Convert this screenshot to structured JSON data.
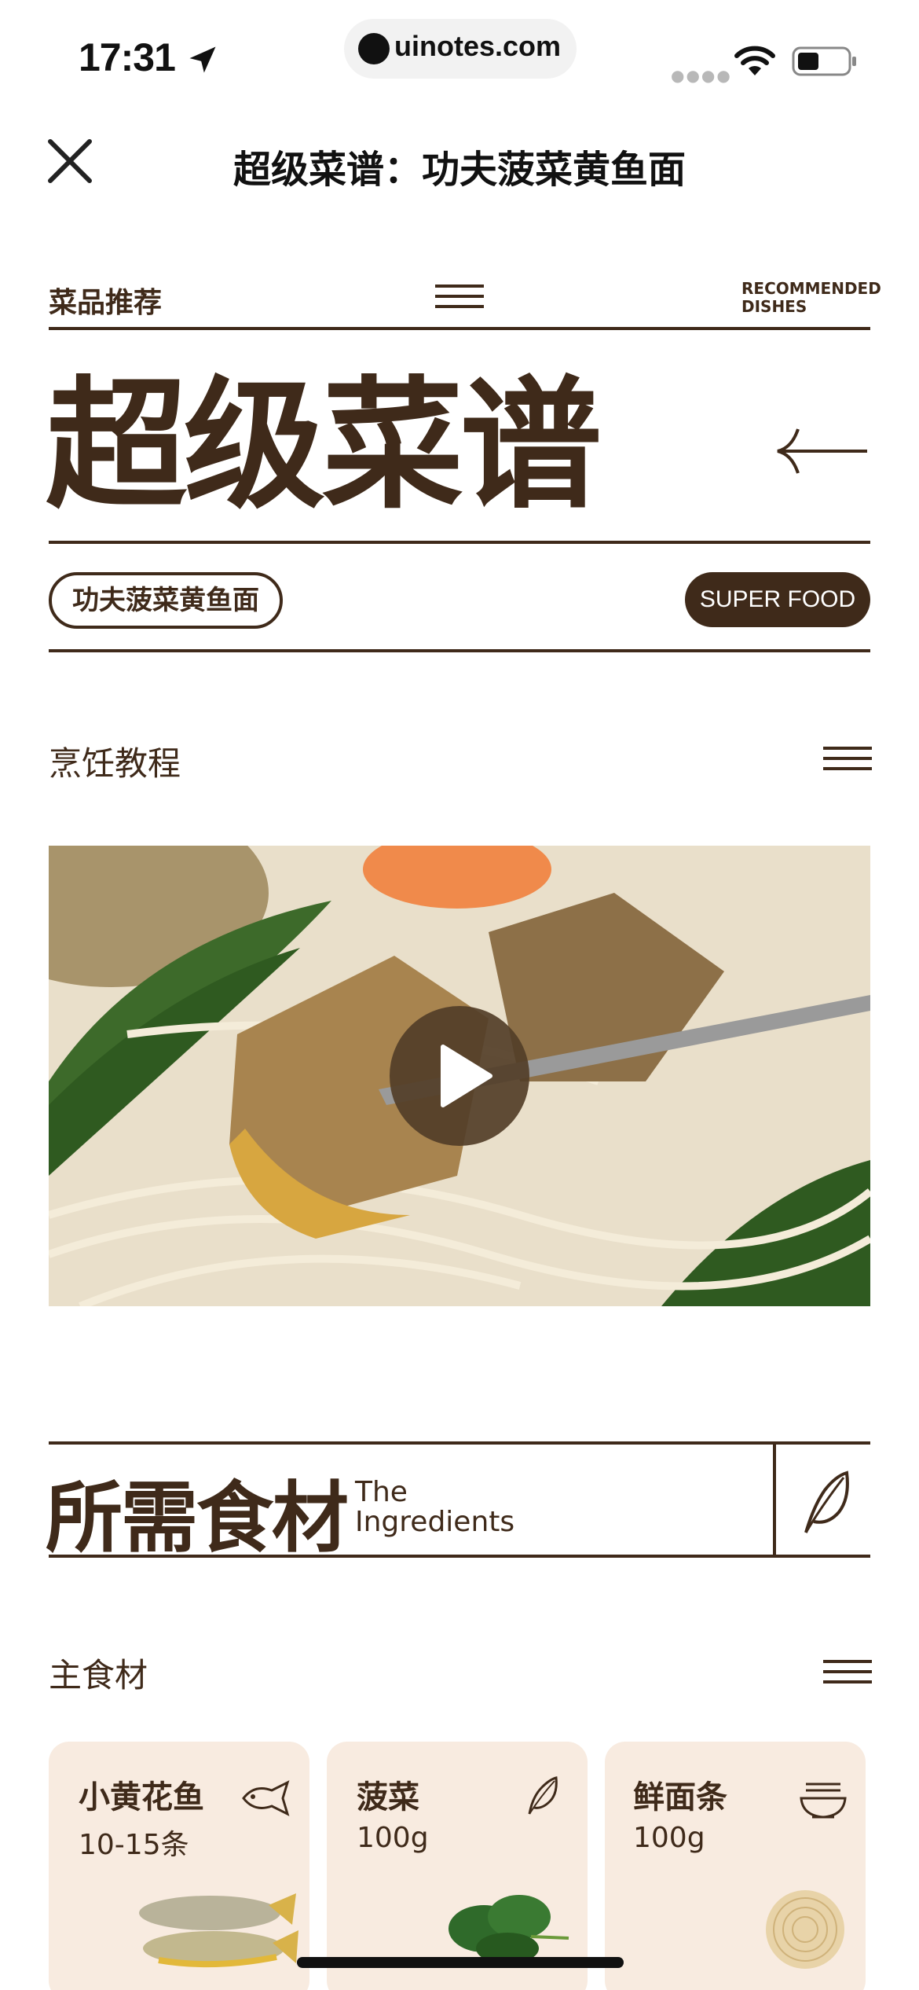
{
  "status_bar": {
    "time": "17:31",
    "url": "uinotes.com"
  },
  "nav": {
    "title": "超级菜谱：功夫菠菜黄鱼面"
  },
  "recommend": {
    "label": "菜品推荐",
    "en_line1": "RECOMMENDED",
    "en_line2": "DISHES"
  },
  "hero": {
    "title": "超级菜谱",
    "dish_tag": "功夫菠菜黄鱼面",
    "super_tag": "SUPER FOOD"
  },
  "tutorial": {
    "label": "烹饪教程"
  },
  "ingredients": {
    "title_cn": "所需食材",
    "title_en_1": "The",
    "title_en_2": "Ingredients"
  },
  "main_ingredients": {
    "label": "主食材",
    "items": [
      {
        "name": "小黄花鱼",
        "qty": "10-15条",
        "icon": "fish-icon"
      },
      {
        "name": "菠菜",
        "qty": "100g",
        "icon": "leaf-icon"
      },
      {
        "name": "鲜面条",
        "qty": "100g",
        "icon": "noodle-bowl-icon"
      }
    ]
  },
  "colors": {
    "brand_brown": "#3f2a1a",
    "card_bg": "#f8ebe0",
    "play_btn": "#533e28"
  }
}
